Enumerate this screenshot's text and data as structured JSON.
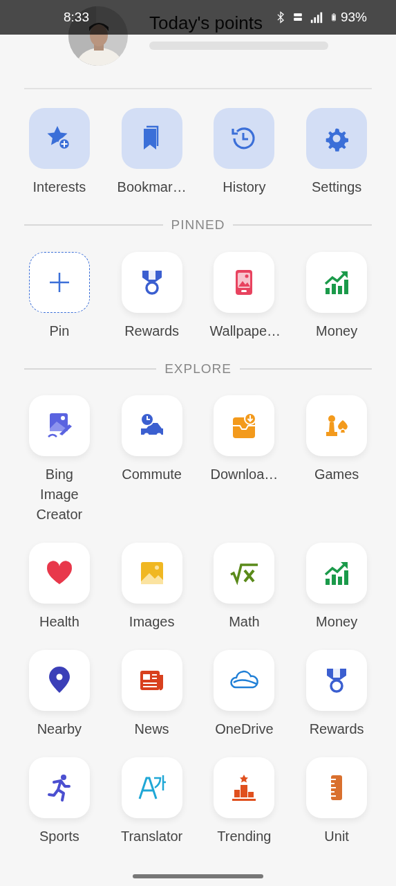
{
  "status_bar": {
    "time": "8:33",
    "battery": "93%"
  },
  "header": {
    "title": "Today's points"
  },
  "quick_actions": [
    {
      "label": "Interests"
    },
    {
      "label": "Bookmar…"
    },
    {
      "label": "History"
    },
    {
      "label": "Settings"
    }
  ],
  "sections": [
    {
      "heading": "PINNED",
      "items": [
        {
          "label": "Pin",
          "kind": "add"
        },
        {
          "label": "Rewards",
          "kind": "app"
        },
        {
          "label": "Wallpape…",
          "kind": "app"
        },
        {
          "label": "Money",
          "kind": "app"
        }
      ]
    },
    {
      "heading": "EXPLORE",
      "items": [
        {
          "label": "Bing Image Creator",
          "kind": "app"
        },
        {
          "label": "Commute",
          "kind": "app"
        },
        {
          "label": "Downloa…",
          "kind": "app"
        },
        {
          "label": "Games",
          "kind": "app"
        },
        {
          "label": "Health",
          "kind": "app"
        },
        {
          "label": "Images",
          "kind": "app"
        },
        {
          "label": "Math",
          "kind": "app"
        },
        {
          "label": "Money",
          "kind": "app"
        },
        {
          "label": "Nearby",
          "kind": "app"
        },
        {
          "label": "News",
          "kind": "app"
        },
        {
          "label": "OneDrive",
          "kind": "app"
        },
        {
          "label": "Rewards",
          "kind": "app"
        },
        {
          "label": "Sports",
          "kind": "app"
        },
        {
          "label": "Translator",
          "kind": "app"
        },
        {
          "label": "Trending",
          "kind": "app"
        },
        {
          "label": "Unit",
          "kind": "app"
        }
      ]
    }
  ]
}
